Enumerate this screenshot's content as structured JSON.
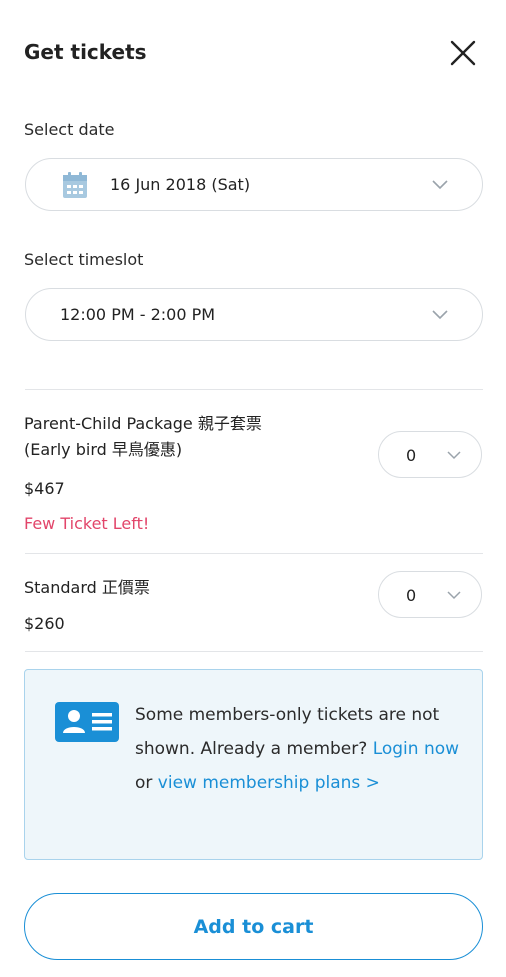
{
  "header": {
    "title": "Get tickets"
  },
  "date_select": {
    "label": "Select date",
    "value": "16 Jun 2018 (Sat)"
  },
  "timeslot_select": {
    "label": "Select timeslot",
    "value": "12:00 PM - 2:00 PM"
  },
  "tickets": [
    {
      "name_line1": "Parent-Child Package 親子套票",
      "name_line2": "(Early bird 早鳥優惠)",
      "price": "$467",
      "notice": "Few Ticket Left!",
      "quantity": "0"
    },
    {
      "name_line1": "Standard 正價票",
      "price": "$260",
      "quantity": "0"
    }
  ],
  "membership": {
    "text": "Some members-only tickets are not shown. Already a member?",
    "login_link": "Login now",
    "connector": "or",
    "plans_link": "view membership plans >"
  },
  "add_to_cart": "Add to cart",
  "colors": {
    "accent": "#1a8fd6",
    "warning": "#e2456a",
    "info_bg": "#eef6fa"
  },
  "icons": [
    "close-icon",
    "calendar-icon",
    "chevron-down-icon",
    "member-card-icon"
  ]
}
